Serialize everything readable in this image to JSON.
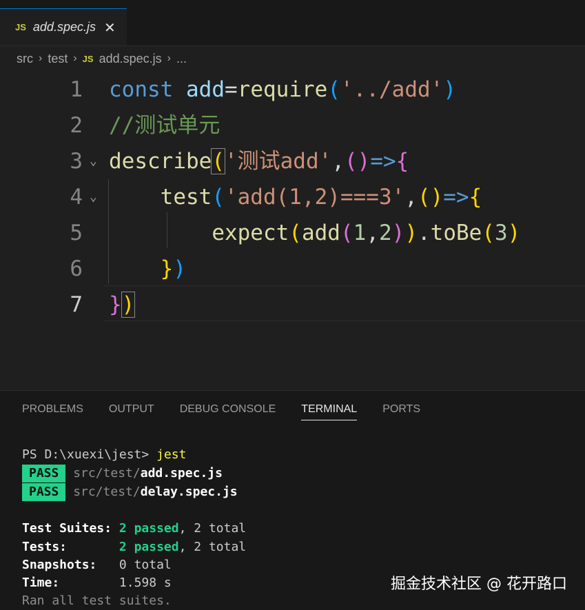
{
  "tab": {
    "icon_label": "JS",
    "name": "add.spec.js",
    "close": "✕"
  },
  "breadcrumb": {
    "parts": [
      "src",
      "test",
      "add.spec.js",
      "..."
    ],
    "icon_label": "JS"
  },
  "editor": {
    "line_numbers": [
      "1",
      "2",
      "3",
      "4",
      "5",
      "6",
      "7"
    ],
    "lines": [
      [
        {
          "t": "const",
          "c": "k"
        },
        {
          "t": " "
        },
        {
          "t": "add",
          "c": "v"
        },
        {
          "t": "="
        },
        {
          "t": "require",
          "c": "f"
        },
        {
          "t": "(",
          "c": "p3"
        },
        {
          "t": "'../add'",
          "c": "s"
        },
        {
          "t": ")",
          "c": "p3"
        }
      ],
      [
        {
          "t": "//测试单元",
          "c": "c"
        }
      ],
      [
        {
          "t": "describe",
          "c": "f"
        },
        {
          "t": "(",
          "c": "p1 box"
        },
        {
          "t": "'测试add'",
          "c": "s"
        },
        {
          "t": ","
        },
        {
          "t": "()",
          "c": "p2"
        },
        {
          "t": "=>",
          "c": "k"
        },
        {
          "t": "{",
          "c": "p2"
        }
      ],
      [
        {
          "t": "    "
        },
        {
          "t": "test",
          "c": "f"
        },
        {
          "t": "(",
          "c": "p3"
        },
        {
          "t": "'add(1,2)===3'",
          "c": "s"
        },
        {
          "t": ","
        },
        {
          "t": "()",
          "c": "p1"
        },
        {
          "t": "=>",
          "c": "k"
        },
        {
          "t": "{",
          "c": "p1"
        }
      ],
      [
        {
          "t": "        "
        },
        {
          "t": "expect",
          "c": "f"
        },
        {
          "t": "(",
          "c": "p1"
        },
        {
          "t": "add",
          "c": "f"
        },
        {
          "t": "(",
          "c": "p2"
        },
        {
          "t": "1",
          "c": "n"
        },
        {
          "t": ","
        },
        {
          "t": "2",
          "c": "n"
        },
        {
          "t": ")",
          "c": "p2"
        },
        {
          "t": ")",
          "c": "p1"
        },
        {
          "t": "."
        },
        {
          "t": "toBe",
          "c": "f"
        },
        {
          "t": "(",
          "c": "p1"
        },
        {
          "t": "3",
          "c": "n"
        },
        {
          "t": ")",
          "c": "p1"
        }
      ],
      [
        {
          "t": "    "
        },
        {
          "t": "}",
          "c": "p1"
        },
        {
          "t": ")",
          "c": "p3"
        }
      ],
      [
        {
          "t": "}",
          "c": "p2"
        },
        {
          "t": ")",
          "c": "p1 box"
        }
      ]
    ]
  },
  "panel": {
    "tabs": [
      "PROBLEMS",
      "OUTPUT",
      "DEBUG CONSOLE",
      "TERMINAL",
      "PORTS"
    ],
    "active_tab": "TERMINAL"
  },
  "terminal": {
    "prompt": "PS D:\\xuexi\\jest> ",
    "command": "jest",
    "results": [
      {
        "status": "PASS",
        "path": "src/test/",
        "file": "add.spec.js"
      },
      {
        "status": "PASS",
        "path": "src/test/",
        "file": "delay.spec.js"
      }
    ],
    "summary": [
      {
        "label": "Test Suites: ",
        "passed": "2 passed",
        "rest": ", 2 total"
      },
      {
        "label": "Tests:       ",
        "passed": "2 passed",
        "rest": ", 2 total"
      },
      {
        "label": "Snapshots:   ",
        "passed": "",
        "rest": "0 total"
      },
      {
        "label": "Time:        ",
        "passed": "",
        "rest": "1.598 s"
      }
    ],
    "footer": "Ran all test suites."
  },
  "watermark": "掘金技术社区 @ 花开路口",
  "colors": {
    "accent": "#0078d4",
    "pass": "#23d18b",
    "background": "#1f1f1f"
  }
}
